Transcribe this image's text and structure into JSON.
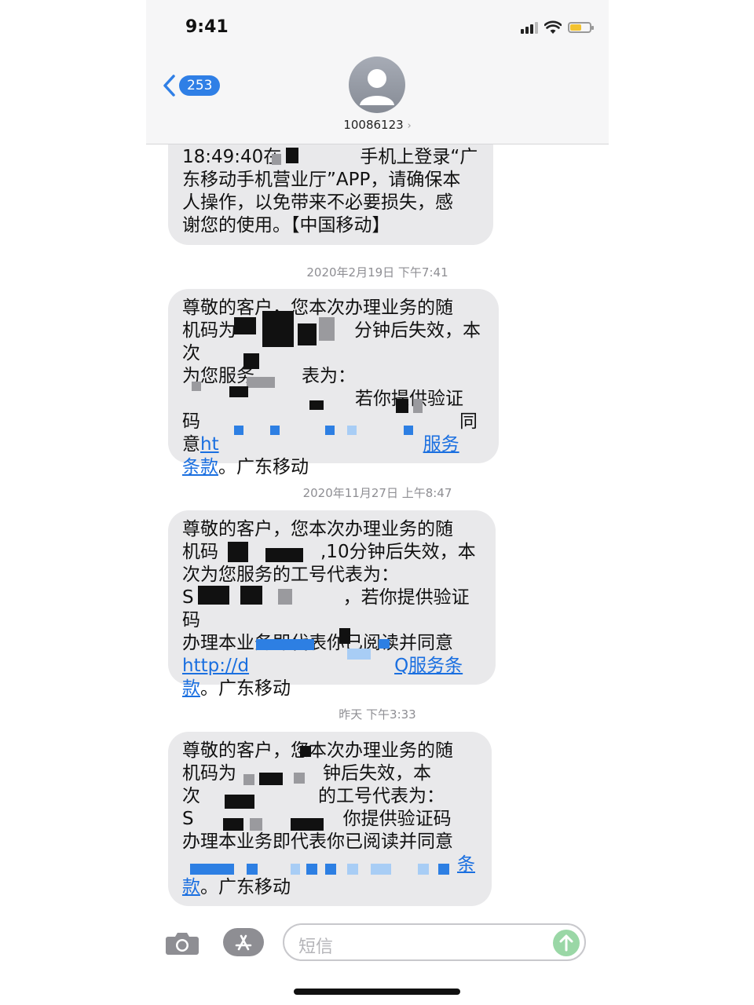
{
  "status_bar": {
    "time": "9:41"
  },
  "header": {
    "back_count": "253",
    "contact_number": "10086123",
    "contact_chevron": "›"
  },
  "messages": [
    {
      "text_line1": "18:49:40在",
      "text_line1b": "手机上登录“广",
      "text_rest": "东移动手机营业厅”APP，请确保本\n人操作，以免带来不必要损失，感\n谢您的使用。【中国移动】"
    },
    {
      "text_a": "尊敬的客户，您本次办理业务的随\n机码为",
      "text_b": "分钟后失效，本次\n为您服务",
      "text_c": "表为：",
      "text_d": "若你提供验证\n码",
      "text_e": "同\n意",
      "link_start": "ht",
      "link_end": "服务\n条款",
      "tail": "。广东移动"
    },
    {
      "text_a": "尊敬的客户，您本次办理业务的随\n机码",
      "text_b": ",10分钟后失效，本\n次为您服务的工号代表为：\nS",
      "text_c": "，若你提供验证码\n办理本业务即代表你已阅读并同意",
      "link_start": "http://d",
      "link_end": "Q服务条\n款",
      "tail": "。广东移动"
    },
    {
      "text_a": "尊敬的客户，您本次办理业务的随\n机码为",
      "text_b": "钟后失效，本\n次",
      "text_c": "的工号代表为：\nS",
      "text_d": "你提供验证码\n办理本业务即代表你已阅读并同意",
      "link_end": "条\n款",
      "tail": "。广东移动"
    }
  ],
  "timestamps": [
    "2020年2月19日 下午7:41",
    "2020年11月27日 上午8:47",
    "昨天 下午3:33"
  ],
  "input": {
    "placeholder": "短信"
  },
  "icons": {
    "back": "chevron-left-icon",
    "avatar": "person-icon",
    "camera": "camera-icon",
    "appstore": "app-store-icon",
    "send": "send-arrow-icon"
  },
  "colors": {
    "accent": "#2f7fe6",
    "bubble": "#e9e9eb",
    "send": "#9ad7a6"
  }
}
